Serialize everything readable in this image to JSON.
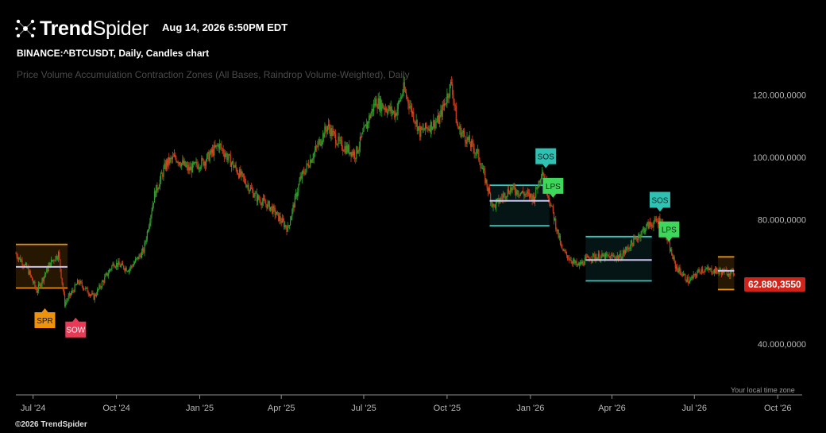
{
  "brand": {
    "name_bold": "Trend",
    "name_light": "Spider",
    "copyright": "©2026 TrendSpider"
  },
  "timestamp": "Aug 14, 2026 6:50PM EDT",
  "symbol_line": "BINANCE:^BTCUSDT, Daily, Candles chart",
  "indicator_line": "Price Volume Accumulation Contraction Zones (All Bases, Raindrop Volume-Weighted), Daily",
  "timezone_note": "Your local time zone",
  "colors": {
    "up": "#2e9e2e",
    "down": "#d43c1c",
    "background": "#000000",
    "zone_orange": "#e8900c",
    "zone_teal": "#35c8c0",
    "poc": "#c9c4ee",
    "last_price_bg": "#d0241a"
  },
  "chart_data": {
    "type": "candlestick",
    "title": "BINANCE:^BTCUSDT, Daily, Candles chart",
    "y_axis": {
      "ticks": [
        120000000,
        100000000,
        80000000,
        40000000
      ],
      "tick_labels": [
        "120.000,0000",
        "100.000,0000",
        "80.000,0000",
        "40.000,0000"
      ],
      "ylim": [
        28000000,
        125000000
      ]
    },
    "x_axis": {
      "ticks": [
        "Jul '24",
        "Oct '24",
        "Jan '25",
        "Apr '25",
        "Jul '25",
        "Oct '25",
        "Jan '26",
        "Apr '26",
        "Jul '26",
        "Oct '26"
      ],
      "range": [
        "2024-06-12",
        "2026-10-28"
      ]
    },
    "last_price": {
      "label": "62.880,3550",
      "value": 62880355
    },
    "price_path": [
      [
        "2024-06-12",
        69000000
      ],
      [
        "2024-06-25",
        64000000
      ],
      [
        "2024-07-05",
        57000000
      ],
      [
        "2024-07-20",
        66000000
      ],
      [
        "2024-07-29",
        69000000
      ],
      [
        "2024-08-05",
        53000000
      ],
      [
        "2024-08-20",
        60000000
      ],
      [
        "2024-09-06",
        55000000
      ],
      [
        "2024-09-28",
        66000000
      ],
      [
        "2024-10-15",
        64000000
      ],
      [
        "2024-10-31",
        70000000
      ],
      [
        "2024-11-12",
        88000000
      ],
      [
        "2024-11-25",
        98000000
      ],
      [
        "2024-12-05",
        100000000
      ],
      [
        "2024-12-20",
        96000000
      ],
      [
        "2025-01-07",
        99000000
      ],
      [
        "2025-01-22",
        104000000
      ],
      [
        "2025-02-08",
        97000000
      ],
      [
        "2025-03-05",
        87000000
      ],
      [
        "2025-03-20",
        84000000
      ],
      [
        "2025-04-08",
        77000000
      ],
      [
        "2025-04-22",
        93000000
      ],
      [
        "2025-05-10",
        103000000
      ],
      [
        "2025-05-22",
        110000000
      ],
      [
        "2025-06-05",
        104000000
      ],
      [
        "2025-06-22",
        101000000
      ],
      [
        "2025-07-14",
        118000000
      ],
      [
        "2025-08-05",
        114000000
      ],
      [
        "2025-08-14",
        122000000
      ],
      [
        "2025-09-01",
        108000000
      ],
      [
        "2025-09-22",
        112000000
      ],
      [
        "2025-10-06",
        124000000
      ],
      [
        "2025-10-12",
        110000000
      ],
      [
        "2025-11-04",
        101000000
      ],
      [
        "2025-11-21",
        84000000
      ],
      [
        "2025-12-10",
        90000000
      ],
      [
        "2026-01-05",
        87000000
      ],
      [
        "2026-01-14",
        96000000
      ],
      [
        "2026-02-05",
        70000000
      ],
      [
        "2026-02-22",
        65000000
      ],
      [
        "2026-03-08",
        68000000
      ],
      [
        "2026-04-10",
        68000000
      ],
      [
        "2026-05-10",
        78000000
      ],
      [
        "2026-05-25",
        80000000
      ],
      [
        "2026-06-10",
        65000000
      ],
      [
        "2026-06-25",
        60000000
      ],
      [
        "2026-07-08",
        64000000
      ],
      [
        "2026-08-14",
        62880355
      ]
    ],
    "zones": [
      {
        "start": "2024-06-12",
        "end": "2024-08-08",
        "top": 72000000,
        "bottom": 58000000,
        "poc": 64800000,
        "color": "orange"
      },
      {
        "start": "2025-11-17",
        "end": "2026-01-22",
        "top": 91000000,
        "bottom": 78000000,
        "poc": 86000000,
        "color": "teal"
      },
      {
        "start": "2026-03-03",
        "end": "2026-05-15",
        "top": 74500000,
        "bottom": 60300000,
        "poc": 67000000,
        "color": "teal"
      },
      {
        "start": "2026-07-27",
        "end": "2026-08-14",
        "top": 68000000,
        "bottom": 57500000,
        "poc": 63500000,
        "color": "orange"
      }
    ],
    "signals": [
      {
        "label": "SPR",
        "date": "2024-07-14",
        "price": 51500000,
        "position": "below",
        "color": "#ee920c",
        "text_color": "#111111"
      },
      {
        "label": "SOW",
        "date": "2024-08-17",
        "price": 48500000,
        "position": "below",
        "color": "#e83a55",
        "text_color": "#ffffff"
      },
      {
        "label": "SOS",
        "date": "2026-01-18",
        "price": 96500000,
        "position": "above",
        "color": "#2fc1b2",
        "text_color": "#0b2826"
      },
      {
        "label": "LPS",
        "date": "2026-01-26",
        "price": 87000000,
        "position": "above",
        "color": "#3fd65c",
        "text_color": "#0b2810"
      },
      {
        "label": "SOS",
        "date": "2026-05-24",
        "price": 82500000,
        "position": "above",
        "color": "#2fc1b2",
        "text_color": "#0b2826"
      },
      {
        "label": "LPS",
        "date": "2026-06-03",
        "price": 73000000,
        "position": "above",
        "color": "#3fd65c",
        "text_color": "#0b2810"
      }
    ]
  }
}
